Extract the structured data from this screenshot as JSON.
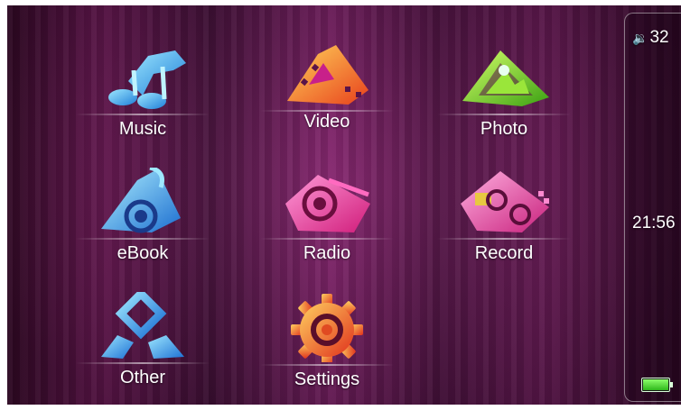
{
  "menu": [
    {
      "id": "music",
      "label": "Music",
      "icon": "music-note-icon"
    },
    {
      "id": "video",
      "label": "Video",
      "icon": "film-strip-icon"
    },
    {
      "id": "photo",
      "label": "Photo",
      "icon": "photo-icon"
    },
    {
      "id": "ebook",
      "label": "eBook",
      "icon": "ebook-icon"
    },
    {
      "id": "radio",
      "label": "Radio",
      "icon": "radio-icon"
    },
    {
      "id": "record",
      "label": "Record",
      "icon": "cassette-icon"
    },
    {
      "id": "other",
      "label": "Other",
      "icon": "diamond-icon"
    },
    {
      "id": "settings",
      "label": "Settings",
      "icon": "gear-icon"
    }
  ],
  "status": {
    "volume_icon": "speaker-icon",
    "volume": "32",
    "time": "21:56",
    "battery_icon": "battery-icon",
    "battery_level": 1.0
  },
  "colors": {
    "background": "#5a1449",
    "label_text": "#ffffff",
    "battery": "#4cd43a"
  }
}
